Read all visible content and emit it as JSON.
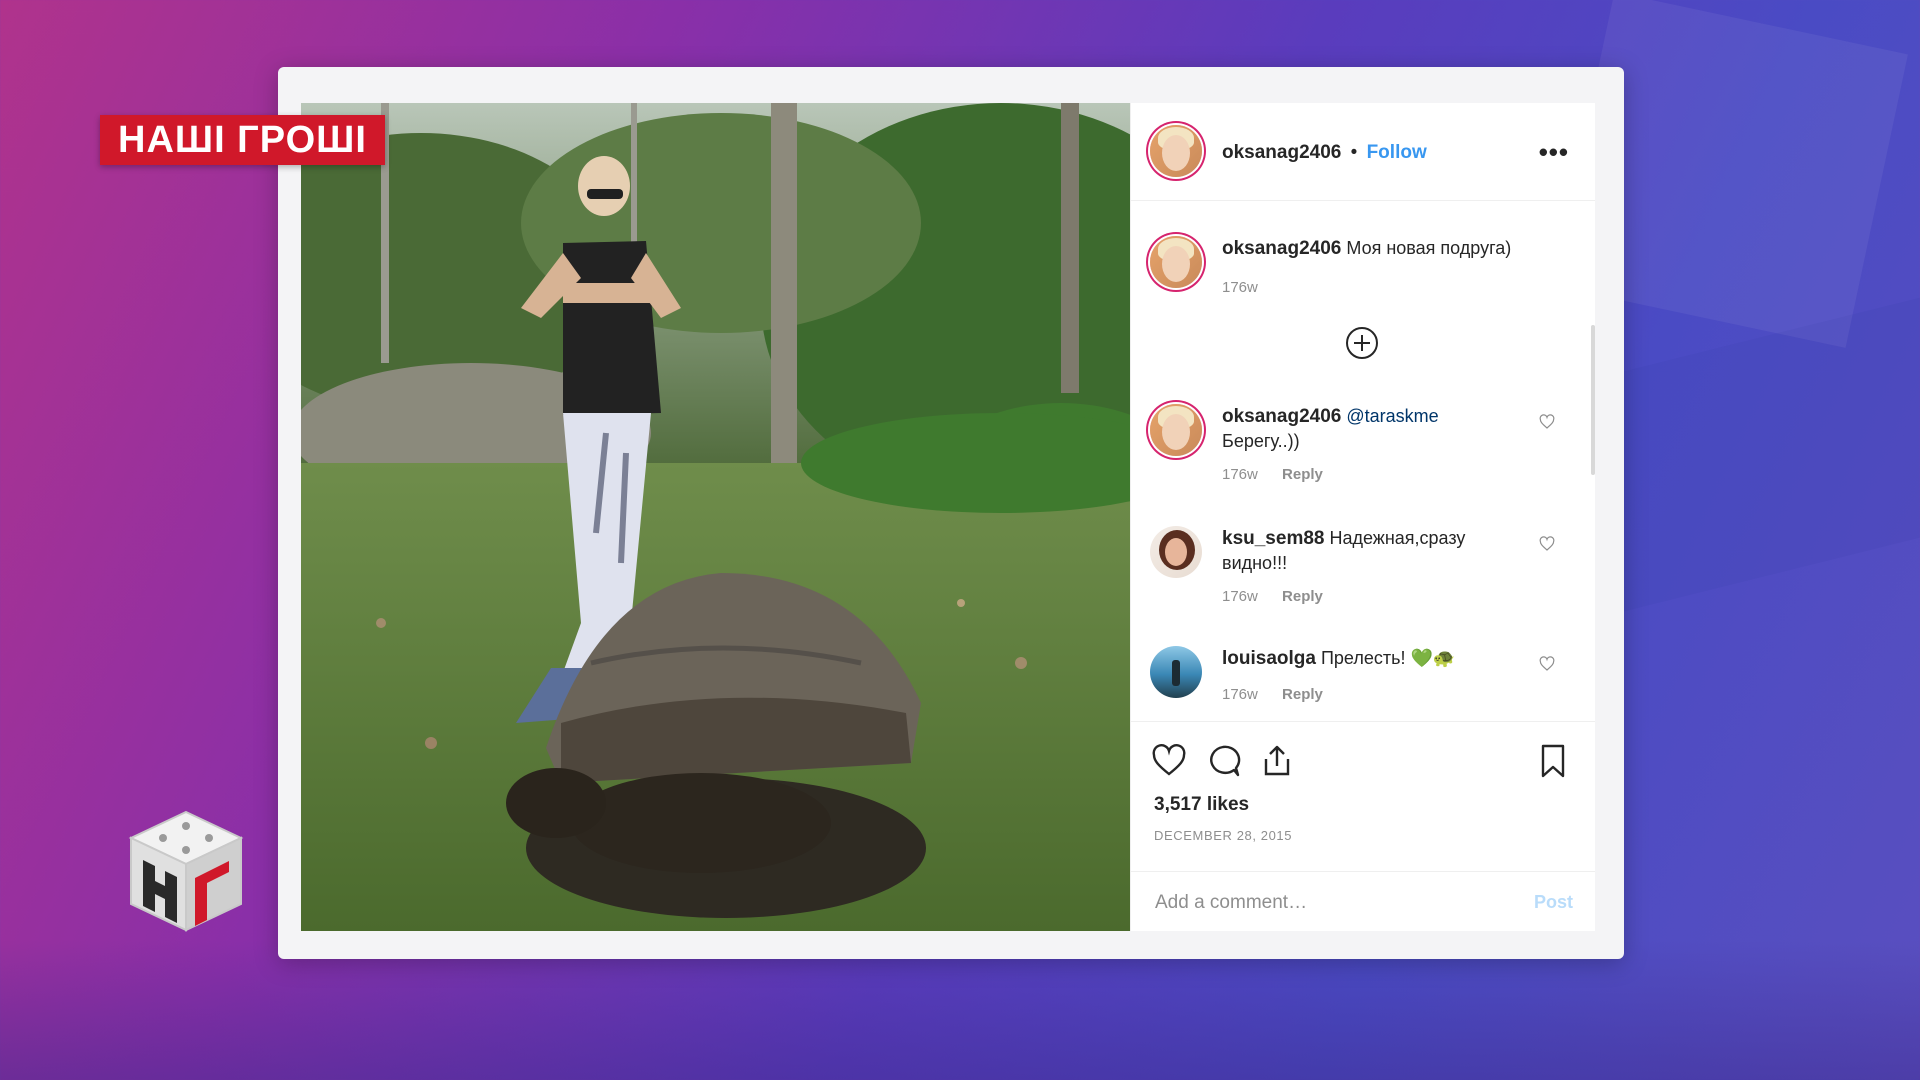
{
  "overlay": {
    "channel_logo": "НАШІ ГРОШІ"
  },
  "post": {
    "author": "oksanag2406",
    "separator": "•",
    "follow_label": "Follow",
    "more_label": "•••",
    "caption": {
      "username": "oksanag2406",
      "text": "Моя новая подруга)",
      "age": "176w"
    },
    "comments": [
      {
        "username": "oksanag2406",
        "mention": "@taraskme",
        "text": "Берегу..))",
        "age": "176w",
        "reply_label": "Reply"
      },
      {
        "username": "ksu_sem88",
        "mention": "",
        "text": "Надежная,сразу видно!!!",
        "age": "176w",
        "reply_label": "Reply"
      },
      {
        "username": "louisaolga",
        "mention": "",
        "text": "Прелесть! 💚🐢",
        "age": "176w",
        "reply_label": "Reply"
      }
    ],
    "likes": "3,517 likes",
    "date": "DECEMBER 28, 2015",
    "comment_placeholder": "Add a comment…",
    "post_label": "Post"
  },
  "icons": {
    "heart": "heart-icon",
    "comment": "comment-icon",
    "share": "share-icon",
    "bookmark": "bookmark-icon",
    "load_more": "plus-circle-icon"
  },
  "colors": {
    "link": "#3897f0",
    "mention": "#003569",
    "post_disabled": "#b9dcfa",
    "logo_red": "#d0182a"
  }
}
